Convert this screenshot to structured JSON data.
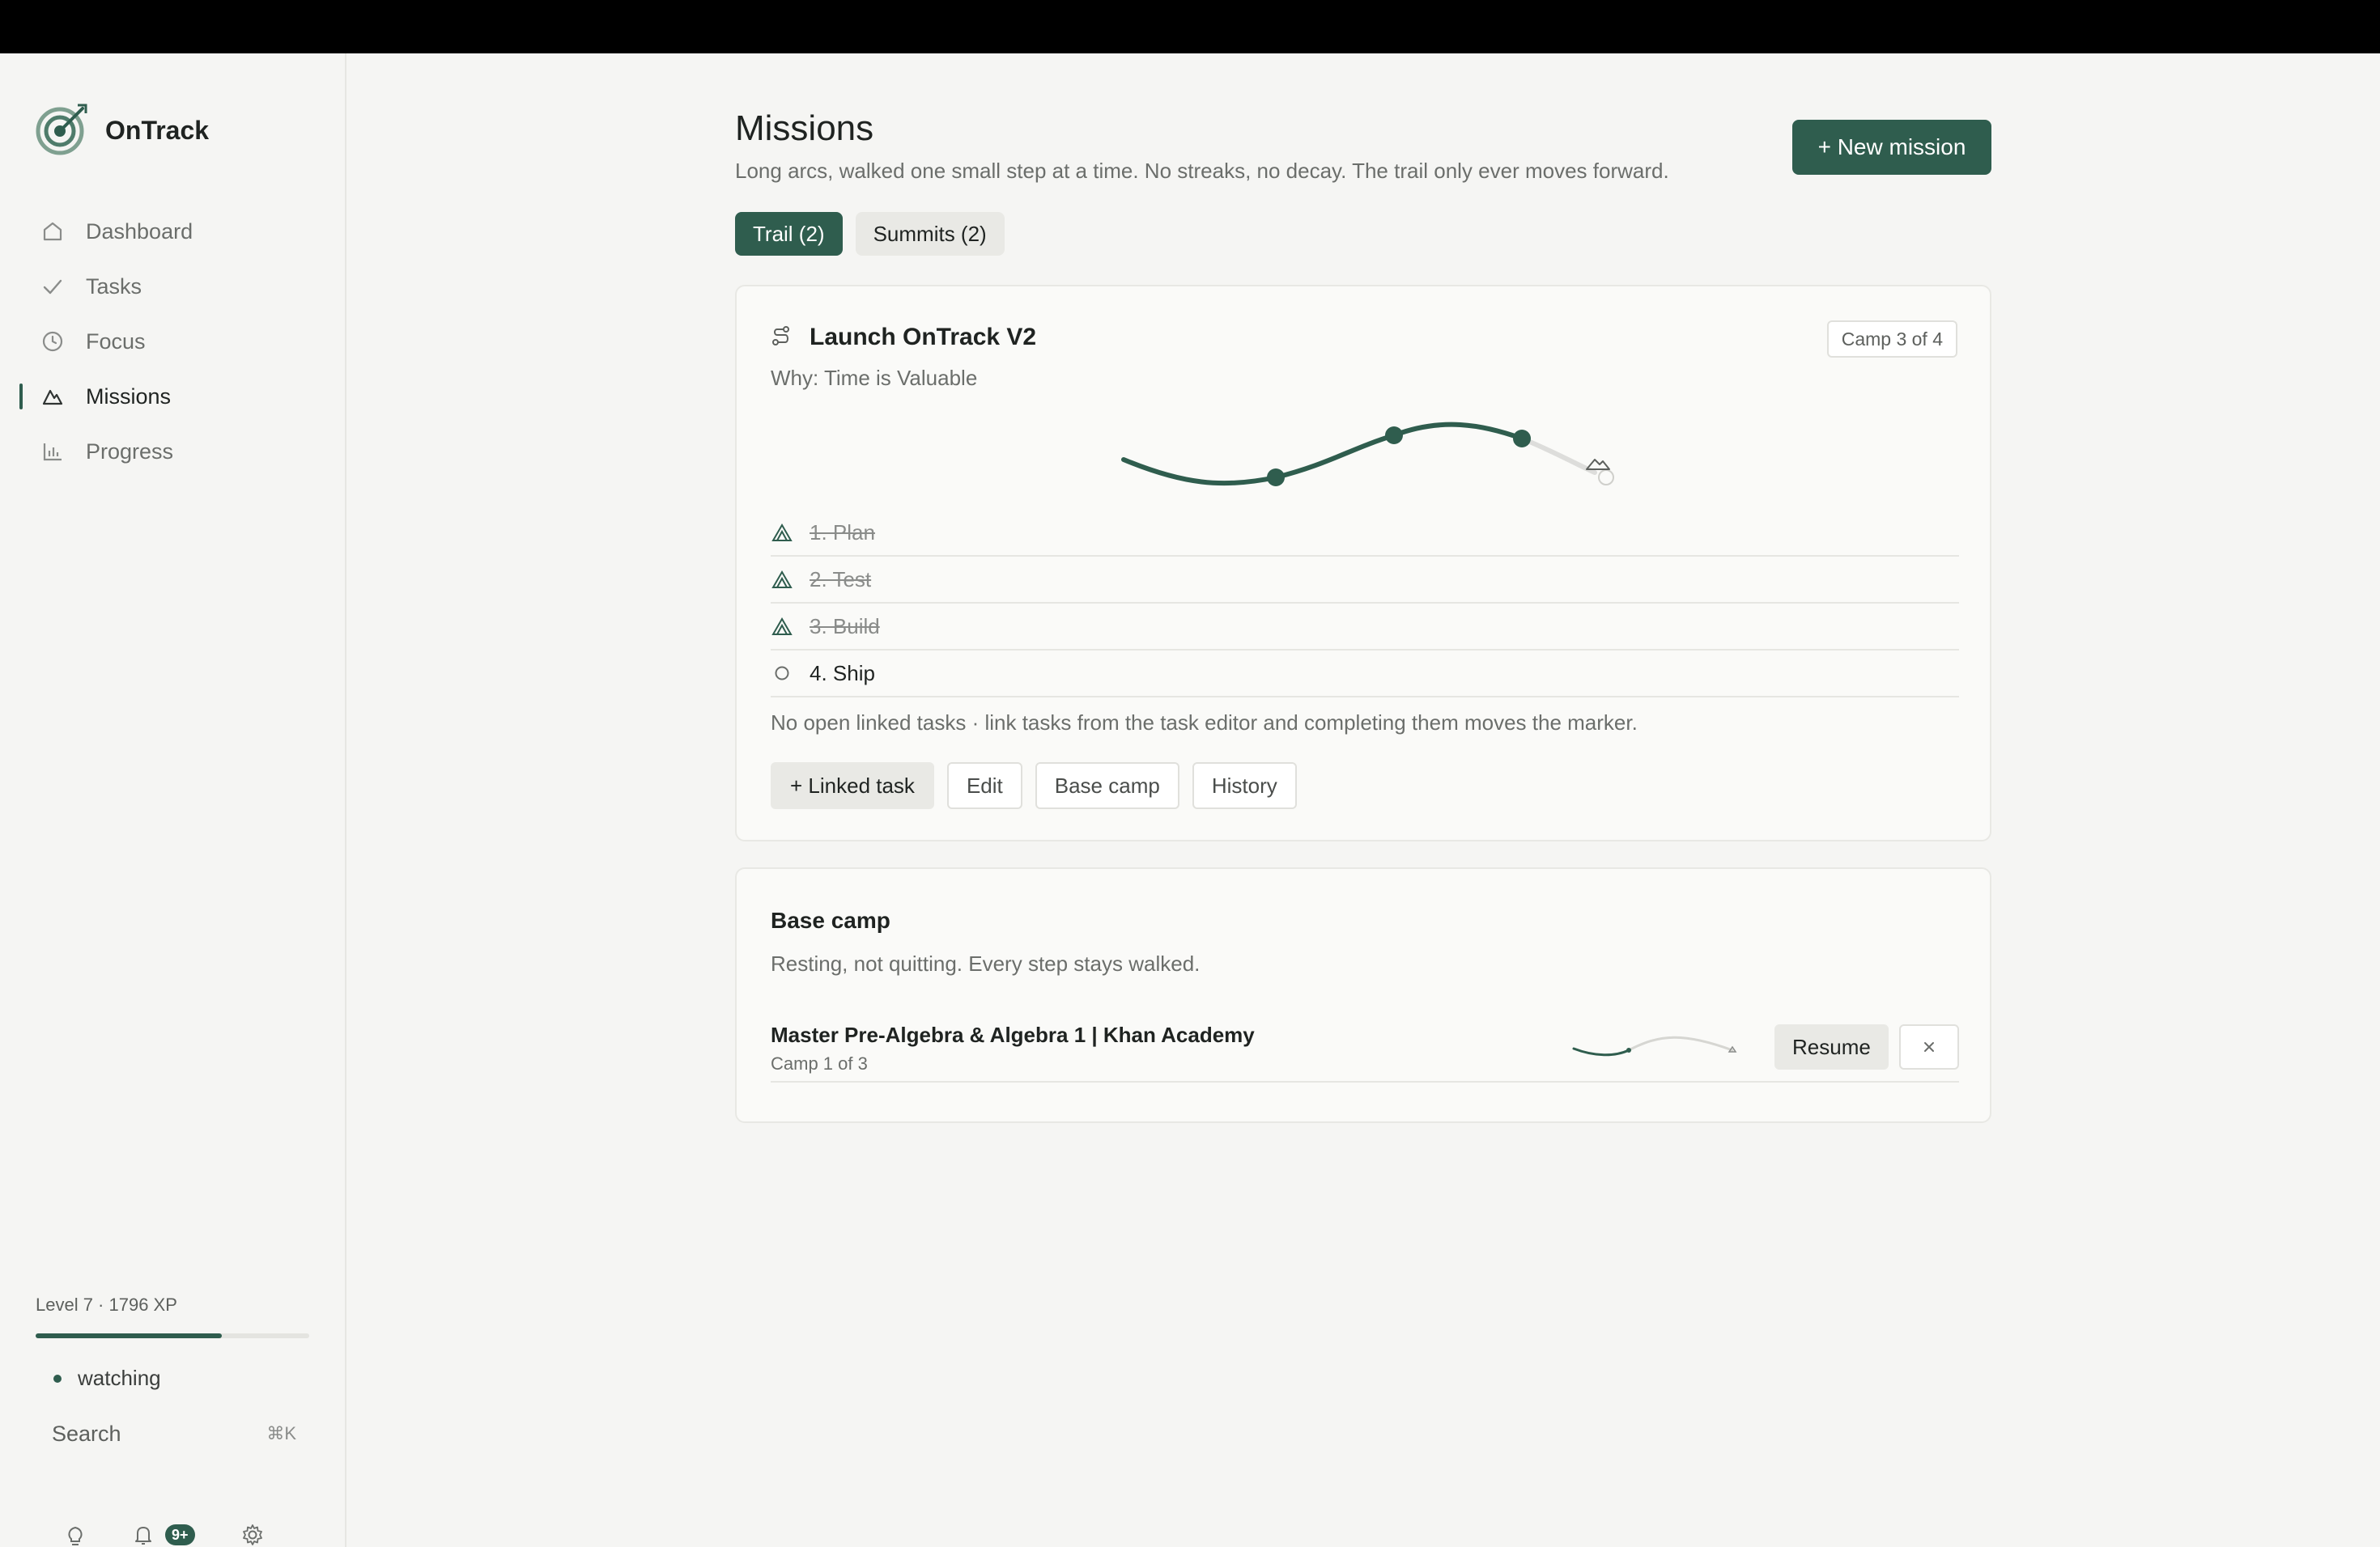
{
  "app": {
    "name": "OnTrack"
  },
  "sidebar": {
    "items": [
      {
        "label": "Dashboard",
        "icon": "home-icon",
        "active": false
      },
      {
        "label": "Tasks",
        "icon": "check-icon",
        "active": false
      },
      {
        "label": "Focus",
        "icon": "clock-icon",
        "active": false
      },
      {
        "label": "Missions",
        "icon": "mountain-icon",
        "active": true
      },
      {
        "label": "Progress",
        "icon": "bar-chart-icon",
        "active": false
      }
    ],
    "level_text": "Level 7 · 1796 XP",
    "xp_progress_fraction": 0.68,
    "status_text": "watching",
    "search_label": "Search",
    "search_shortcut": "⌘K",
    "notification_badge": "9+"
  },
  "main": {
    "title": "Missions",
    "subtitle": "Long arcs, walked one small step at a time. No streaks, no decay. The trail only ever moves forward.",
    "new_mission_label": "+ New mission",
    "tabs": [
      {
        "label": "Trail (2)",
        "active": true
      },
      {
        "label": "Summits (2)",
        "active": false
      }
    ],
    "mission": {
      "title": "Launch OnTrack V2",
      "camp_badge": "Camp 3 of 4",
      "why": "Why: Time is Valuable",
      "camps": [
        {
          "label": "1. Plan",
          "done": true
        },
        {
          "label": "2. Test",
          "done": true
        },
        {
          "label": "3. Build",
          "done": true
        },
        {
          "label": "4. Ship",
          "done": false
        }
      ],
      "note": "No open linked tasks · link tasks from the task editor and completing them moves the marker.",
      "actions": [
        "+ Linked task",
        "Edit",
        "Base camp",
        "History"
      ]
    },
    "base_camp": {
      "title": "Base camp",
      "subtitle": "Resting, not quitting. Every step stays walked.",
      "items": [
        {
          "name": "Master Pre-Algebra & Algebra 1 | Khan Academy",
          "camp": "Camp 1 of 3",
          "resume_label": "Resume"
        }
      ]
    }
  },
  "colors": {
    "accent": "#2f5d4e",
    "background": "#f5f5f3",
    "card": "#fafaf8"
  }
}
